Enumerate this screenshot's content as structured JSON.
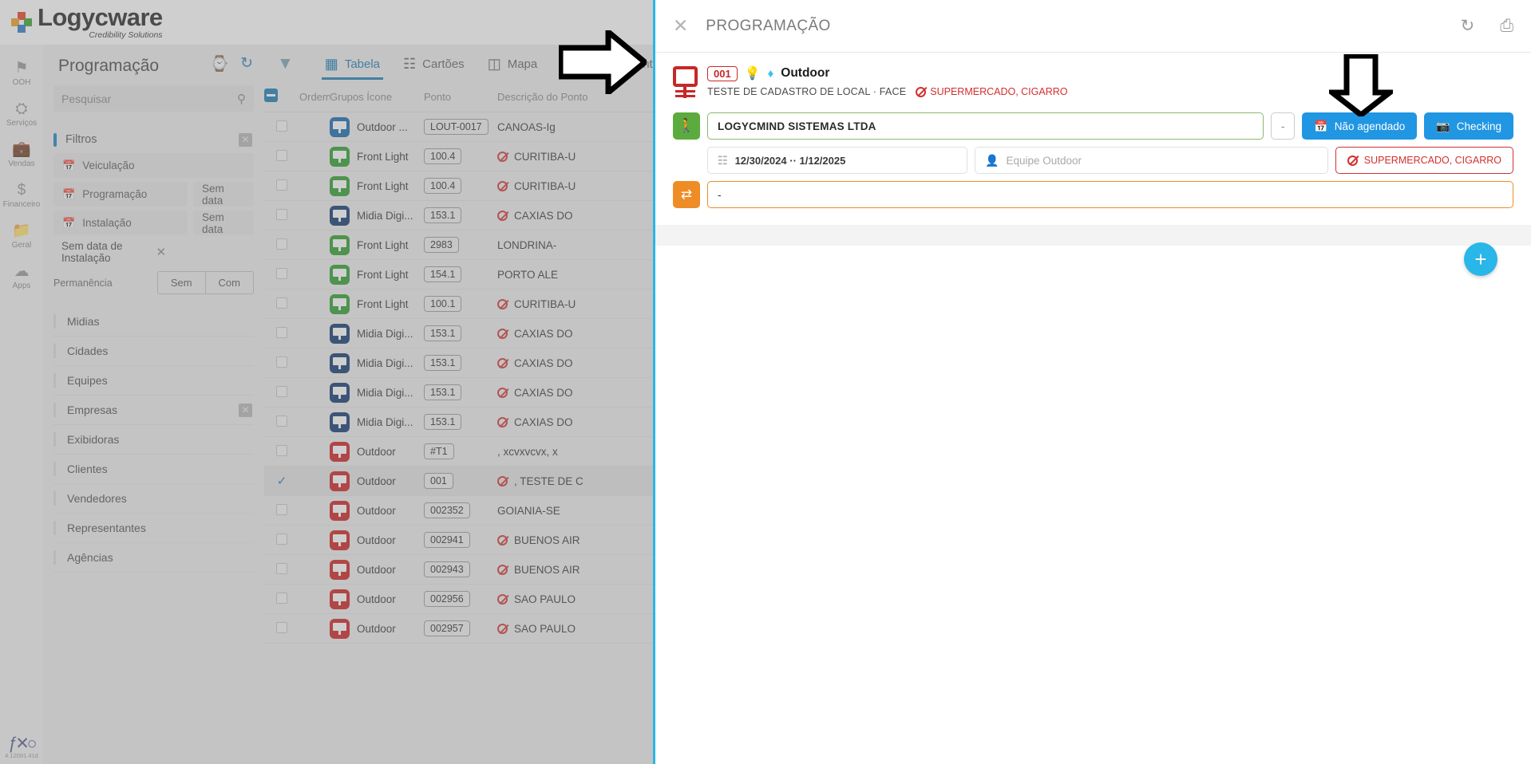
{
  "brand": {
    "name": "Logycware",
    "tagline": "Credibility Solutions"
  },
  "rail": {
    "items": [
      {
        "label": "OOH",
        "icon": "flag-icon",
        "glyph": "⚑"
      },
      {
        "label": "Serviços",
        "icon": "services-icon",
        "glyph": "⛭"
      },
      {
        "label": "Vendas",
        "icon": "briefcase-icon",
        "glyph": "💼"
      },
      {
        "label": "Financeiro",
        "icon": "dollar-icon",
        "glyph": "$"
      },
      {
        "label": "Geral",
        "icon": "folder-icon",
        "glyph": "📁"
      },
      {
        "label": "Apps",
        "icon": "apps-cloud-icon",
        "glyph": "☁"
      }
    ],
    "version": "4.12091.41d",
    "version_logo": "fx-infinity-logo"
  },
  "panel": {
    "title": "Programação",
    "history_icon": "history-clock-icon",
    "refresh_icon": "refresh-icon",
    "search": {
      "placeholder": "Pesquisar",
      "value": "",
      "icon": "search-icon"
    },
    "filters_section": {
      "title": "Filtros",
      "close_icon": "close-icon",
      "chips": [
        {
          "label": "Veiculação",
          "icon": "calendar-plus-icon",
          "value": ""
        },
        {
          "label": "Programação",
          "icon": "calendar-plus-icon",
          "value": "Sem data"
        },
        {
          "label": "Instalação",
          "icon": "calendar-plus-icon",
          "value": "Sem data"
        }
      ],
      "active_tag": "Sem data de Instalação",
      "permanence_label": "Permanência",
      "permanence_options": [
        "Sem",
        "Com"
      ]
    },
    "menu": [
      {
        "label": "Midias",
        "has_clear": false
      },
      {
        "label": "Cidades",
        "has_clear": false
      },
      {
        "label": "Equipes",
        "has_clear": false
      },
      {
        "label": "Empresas",
        "has_clear": true
      },
      {
        "label": "Exibidoras",
        "has_clear": false
      },
      {
        "label": "Clientes",
        "has_clear": false
      },
      {
        "label": "Vendedores",
        "has_clear": false
      },
      {
        "label": "Representantes",
        "has_clear": false
      },
      {
        "label": "Agências",
        "has_clear": false
      }
    ]
  },
  "viewbar": {
    "filter_icon": "funnel-icon",
    "tabs": [
      {
        "label": "Tabela",
        "icon": "table-icon",
        "active": true
      },
      {
        "label": "Cartões",
        "icon": "cards-icon",
        "active": false
      },
      {
        "label": "Mapa",
        "icon": "map-icon",
        "active": false
      },
      {
        "label": "Agendamento",
        "icon": "calendar-icon",
        "active": false
      }
    ]
  },
  "table": {
    "headers": [
      "",
      "Ordem",
      "Grupos Ícone",
      "Ponto",
      "Descrição do Ponto"
    ],
    "rows": [
      {
        "group": "Outdoor ...",
        "color": "blue",
        "ponto": "LOUT-0017",
        "blocked": false,
        "desc": "CANOAS-Ig",
        "selected": false
      },
      {
        "group": "Front Light",
        "color": "green",
        "ponto": "100.4",
        "blocked": true,
        "desc": "CURITIBA-U",
        "selected": false
      },
      {
        "group": "Front Light",
        "color": "green",
        "ponto": "100.4",
        "blocked": true,
        "desc": "CURITIBA-U",
        "selected": false
      },
      {
        "group": "Midia Digi...",
        "color": "navy",
        "ponto": "153.1",
        "blocked": true,
        "desc": "CAXIAS DO",
        "selected": false
      },
      {
        "group": "Front Light",
        "color": "green",
        "ponto": "2983",
        "blocked": false,
        "desc": "LONDRINA-",
        "selected": false
      },
      {
        "group": "Front Light",
        "color": "green",
        "ponto": "154.1",
        "blocked": false,
        "desc": "PORTO ALE",
        "selected": false
      },
      {
        "group": "Front Light",
        "color": "green",
        "ponto": "100.1",
        "blocked": true,
        "desc": "CURITIBA-U",
        "selected": false
      },
      {
        "group": "Midia Digi...",
        "color": "navy",
        "ponto": "153.1",
        "blocked": true,
        "desc": "CAXIAS DO",
        "selected": false
      },
      {
        "group": "Midia Digi...",
        "color": "navy",
        "ponto": "153.1",
        "blocked": true,
        "desc": "CAXIAS DO",
        "selected": false
      },
      {
        "group": "Midia Digi...",
        "color": "navy",
        "ponto": "153.1",
        "blocked": true,
        "desc": "CAXIAS DO",
        "selected": false
      },
      {
        "group": "Midia Digi...",
        "color": "navy",
        "ponto": "153.1",
        "blocked": true,
        "desc": "CAXIAS DO",
        "selected": false
      },
      {
        "group": "Outdoor",
        "color": "red",
        "ponto": "#T1",
        "blocked": false,
        "desc": ", xcvxvcvx, x",
        "selected": false
      },
      {
        "group": "Outdoor",
        "color": "red",
        "ponto": "001",
        "blocked": true,
        "desc": ", TESTE DE C",
        "selected": true
      },
      {
        "group": "Outdoor",
        "color": "red",
        "ponto": "002352",
        "blocked": false,
        "desc": "GOIANIA-SE",
        "selected": false
      },
      {
        "group": "Outdoor",
        "color": "red",
        "ponto": "002941",
        "blocked": true,
        "desc": "BUENOS AIR",
        "selected": false
      },
      {
        "group": "Outdoor",
        "color": "red",
        "ponto": "002943",
        "blocked": true,
        "desc": "BUENOS AIR",
        "selected": false
      },
      {
        "group": "Outdoor",
        "color": "red",
        "ponto": "002956",
        "blocked": true,
        "desc": "SAO PAULO",
        "selected": false
      },
      {
        "group": "Outdoor",
        "color": "red",
        "ponto": "002957",
        "blocked": true,
        "desc": "SAO PAULO",
        "selected": false
      }
    ]
  },
  "overlay": {
    "close_icon": "close-icon",
    "title": "PROGRAMAÇÃO",
    "refresh_icon": "refresh-icon",
    "print_icon": "print-icon",
    "media": {
      "board_icon": "billboard-icon",
      "code": "001",
      "bulb_icon": "lightbulb-icon",
      "gem_icon": "diamond-icon",
      "name": "Outdoor",
      "description": "TESTE DE CADASTRO DE LOCAL · FACE",
      "restriction": "SUPERMERCADO, CIGARRO",
      "restriction_icon": "no-entry-icon"
    },
    "form": {
      "company_icon": "walk-arrow-icon",
      "company_value": "LOGYCMIND SISTEMAS LTDA",
      "dash_label": "-",
      "schedule_button": {
        "label": "Não agendado",
        "icon": "calendar-x-icon",
        "color": "#2196e3"
      },
      "checking_button": {
        "label": "Checking",
        "icon": "camera-icon",
        "color": "#2196e3"
      },
      "date_range": "12/30/2024 ·· 1/12/2025",
      "date_icon": "date-range-icon",
      "team_placeholder": "Equipe Outdoor",
      "team_icon": "person-icon",
      "restriction_tag": "SUPERMERCADO, CIGARRO",
      "restriction_tag_icon": "no-entry-icon",
      "notes_icon": "transfer-icon",
      "notes_value": "-"
    },
    "add_button": {
      "icon": "plus-icon",
      "label": "+",
      "color": "#29b6e8"
    }
  },
  "annotations": {
    "arrow_right": "arrow-right-annotation",
    "arrow_down": "arrow-down-annotation"
  }
}
